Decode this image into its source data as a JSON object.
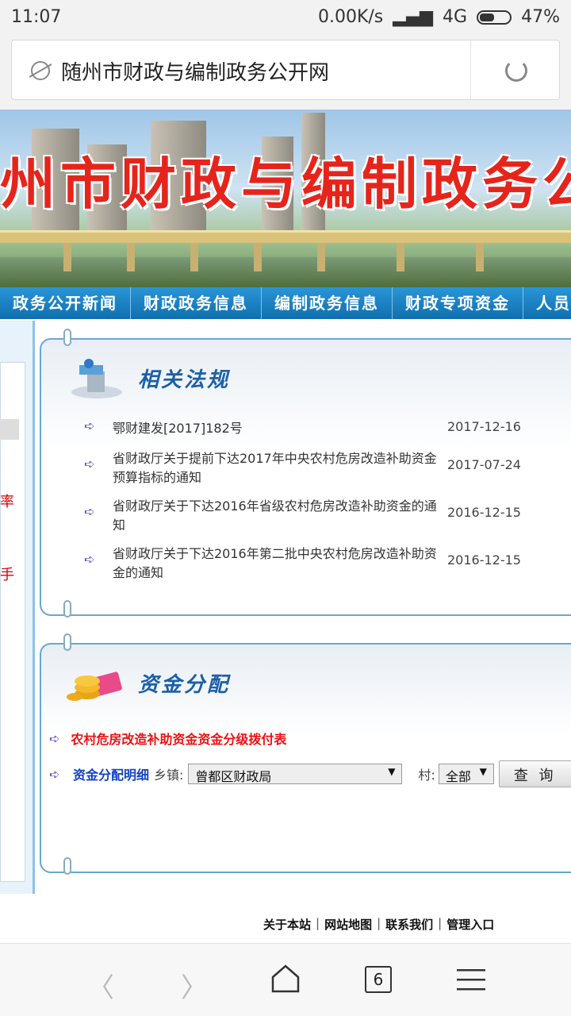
{
  "status": {
    "time": "11:07",
    "speed": "0.00K/s",
    "network": "4G",
    "battery": "47%"
  },
  "browser": {
    "url_title": "随州市财政与编制政务公开网",
    "tab_count": "6"
  },
  "banner": {
    "title": "州市财政与编制政务公开"
  },
  "nav": [
    "政务公开新闻",
    "财政政务信息",
    "编制政务信息",
    "财政专项资金",
    "人员"
  ],
  "regulations": {
    "title": "相关法规",
    "items": [
      {
        "text": "鄂财建发[2017]182号",
        "date": "2017-12-16"
      },
      {
        "text": "省财政厅关于提前下达2017年中央农村危房改造补助资金预算指标的通知",
        "date": "2017-07-24"
      },
      {
        "text": "省财政厅关于下达2016年省级农村危房改造补助资金的通知",
        "date": "2016-12-15"
      },
      {
        "text": "省财政厅关于下达2016年第二批中央农村危房改造补助资金的通知",
        "date": "2016-12-15"
      }
    ]
  },
  "funds": {
    "title": "资金分配",
    "link": "农村危房改造补助资金资金分级拨付表",
    "detail_label": "资金分配明细",
    "township_label": "乡镇:",
    "township_value": "曾都区财政局",
    "village_label": "村:",
    "village_value": "全部",
    "query_button": "查 询"
  },
  "footer": {
    "about": "关于本站",
    "sitemap": "网站地图",
    "contact": "联系我们",
    "admin": "管理入口",
    "sep": "|"
  },
  "left": {
    "char1": "率",
    "char2": "手"
  }
}
